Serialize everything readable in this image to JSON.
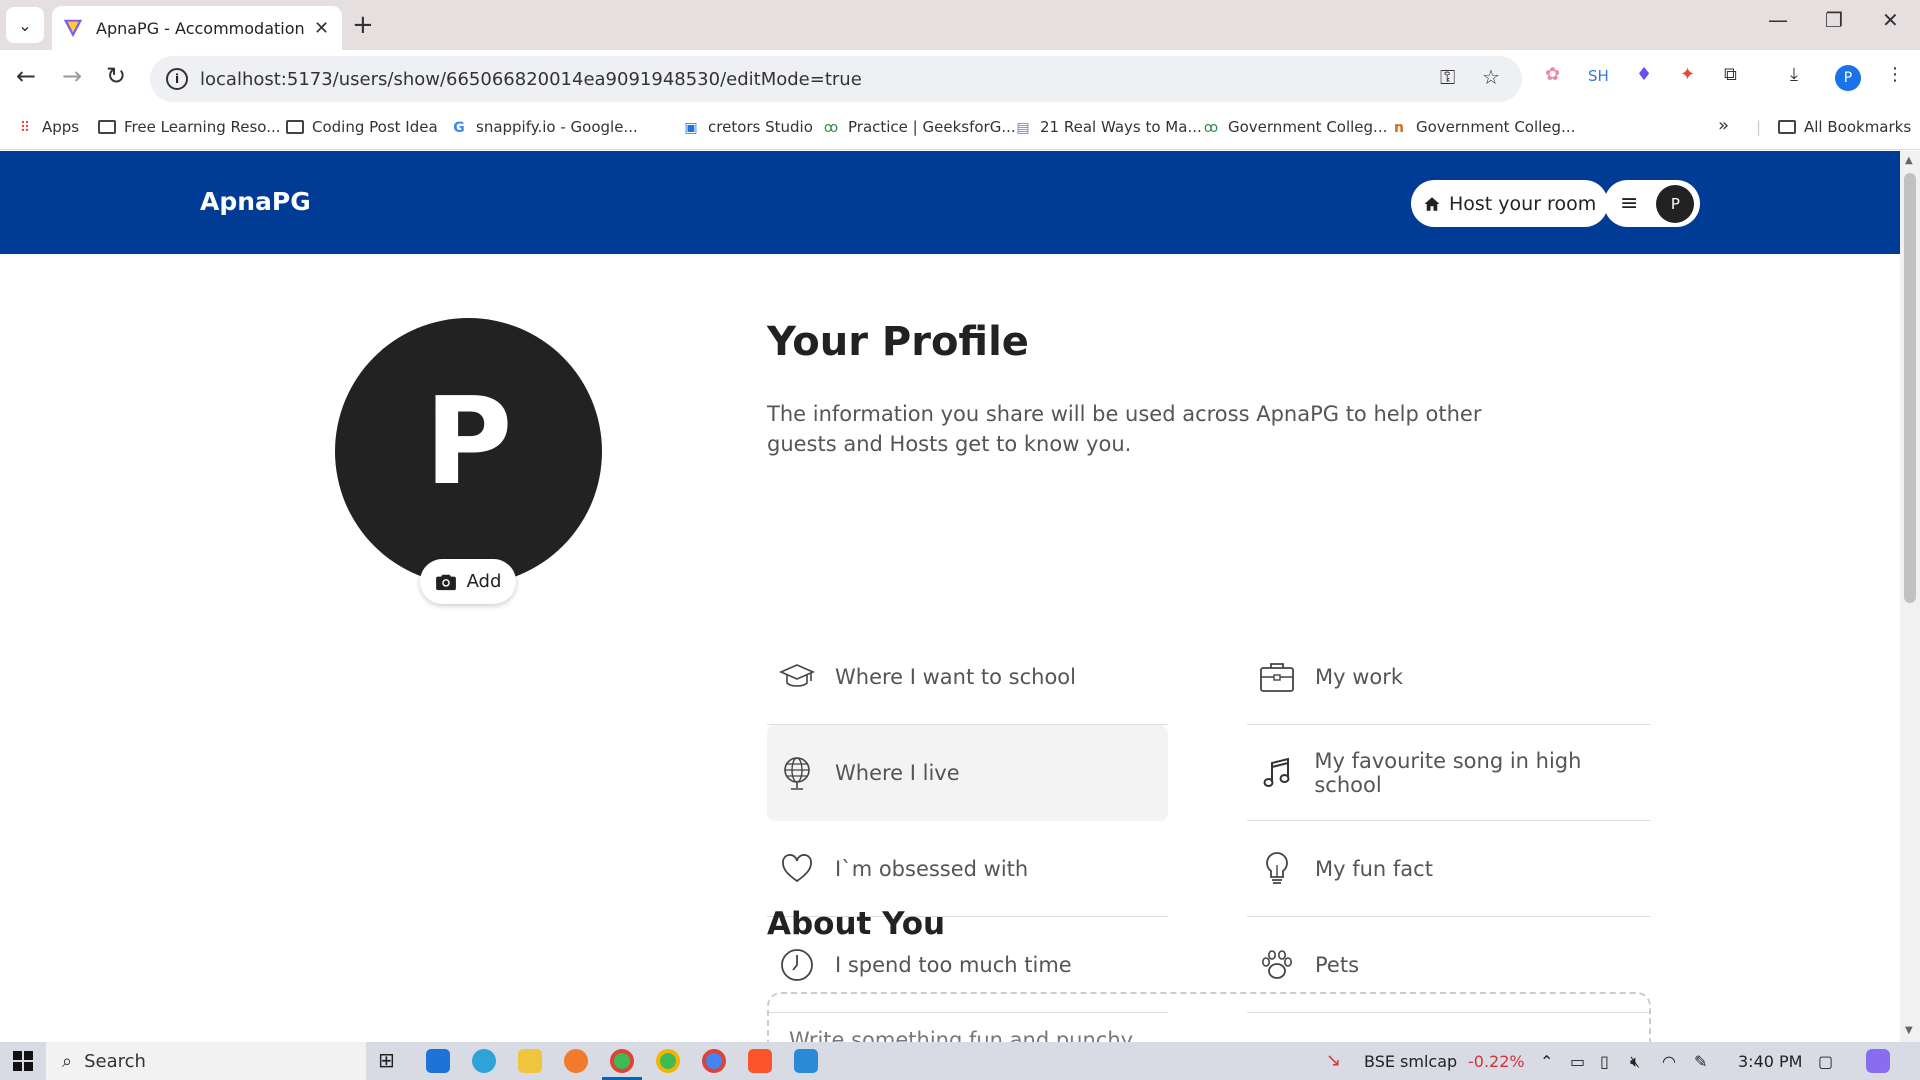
{
  "browser": {
    "tab_title": "ApnaPG - Accommodation Solu",
    "url": "localhost:5173/users/show/665066820014ea9091948530/editMode=true",
    "profile_initial": "P",
    "ext_sh_label": "SH",
    "bookmarks": [
      {
        "label": "Apps",
        "icon": "apps-grid-icon"
      },
      {
        "label": "Free Learning Reso...",
        "icon": "folder-icon"
      },
      {
        "label": "Coding Post Idea",
        "icon": "folder-icon"
      },
      {
        "label": "snappify.io - Google...",
        "icon": "google-icon"
      },
      {
        "label": "cretors Studio",
        "icon": "studio-icon"
      },
      {
        "label": "Practice | GeeksforG...",
        "icon": "geeksforgeeks-icon"
      },
      {
        "label": "21 Real Ways to Ma...",
        "icon": "docs-icon"
      },
      {
        "label": "Government Colleg...",
        "icon": "geeksforgeeks-icon"
      },
      {
        "label": "Government Colleg...",
        "icon": "tn-icon"
      }
    ],
    "all_bookmarks_label": "All Bookmarks"
  },
  "site": {
    "brand": "ApnaPG",
    "host_button": "Host your room",
    "user_initial": "P"
  },
  "profile": {
    "avatar_initial": "P",
    "add_photo_label": "Add",
    "title": "Your Profile",
    "description": "The information you share will be used across ApnaPG to help other guests and Hosts get to know you.",
    "left_items": [
      {
        "label": "Where I want to school",
        "icon": "graduation-cap-icon"
      },
      {
        "label": "Where I live",
        "icon": "globe-icon"
      },
      {
        "label": "I`m obsessed with",
        "icon": "heart-icon"
      },
      {
        "label": "I spend too much time",
        "icon": "clock-icon"
      }
    ],
    "right_items": [
      {
        "label": "My work",
        "icon": "briefcase-icon"
      },
      {
        "label": "My favourite song in high school",
        "icon": "music-note-icon"
      },
      {
        "label": "My fun fact",
        "icon": "lightbulb-icon"
      },
      {
        "label": "Pets",
        "icon": "paw-icon"
      }
    ],
    "about_title": "About You",
    "about_placeholder": "Write something fun and punchy"
  },
  "taskbar": {
    "search_label": "Search",
    "stock_name": "BSE smlcap",
    "stock_change": "-0.22%",
    "time": "3:40 PM"
  },
  "colors": {
    "nav_blue": "#003b95",
    "stock_negative": "#d13438"
  }
}
